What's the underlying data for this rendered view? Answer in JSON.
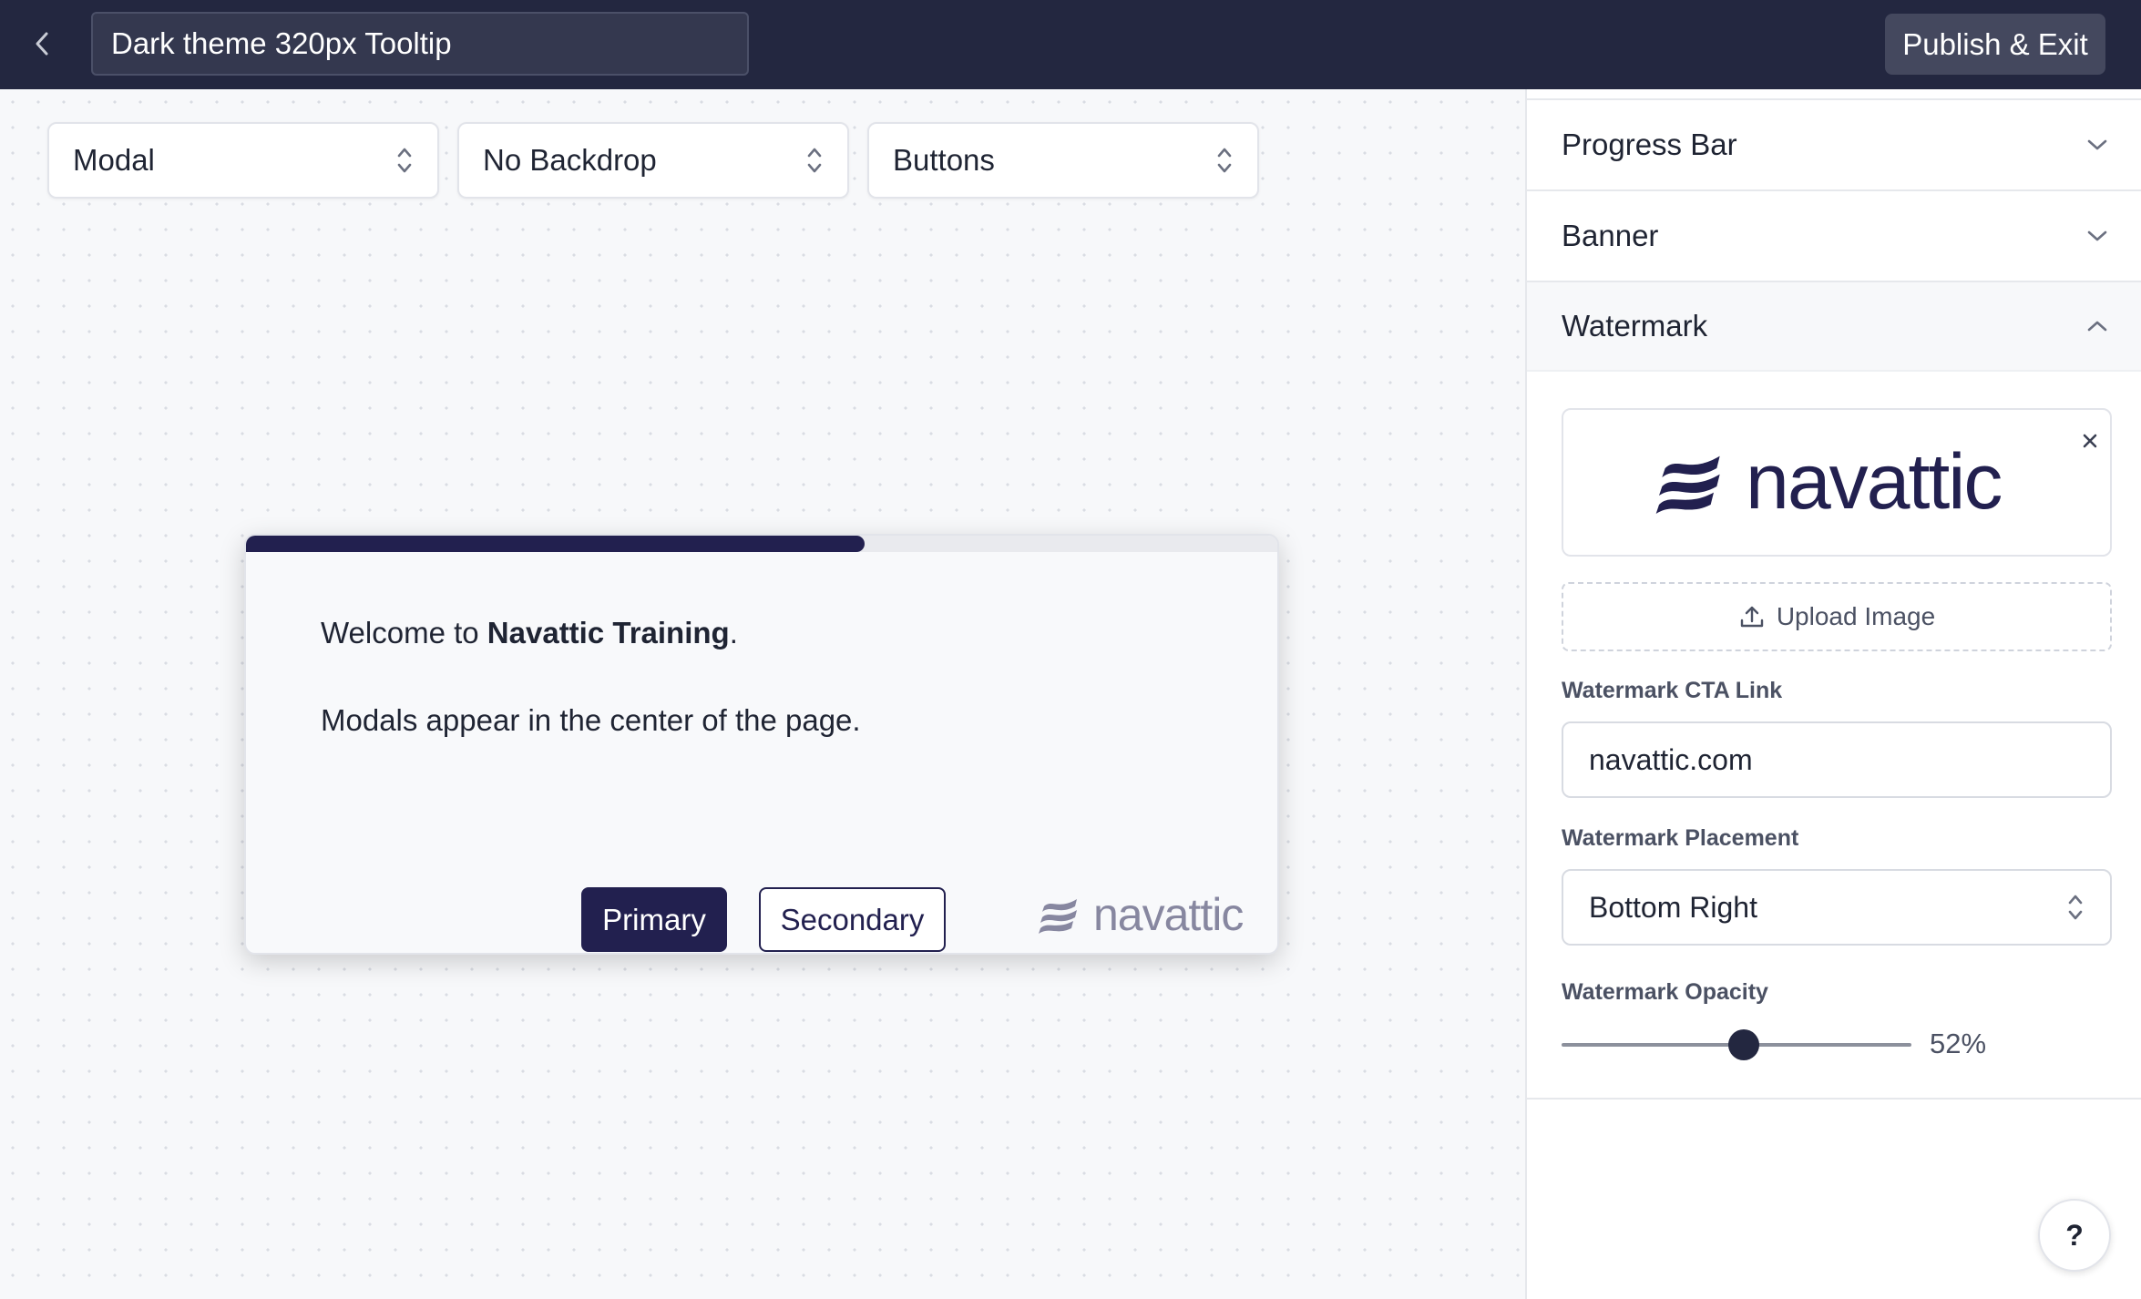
{
  "header": {
    "title_value": "Dark theme 320px Tooltip",
    "publish_label": "Publish & Exit"
  },
  "toolbar": {
    "type_select": "Modal",
    "backdrop_select": "No Backdrop",
    "footer_select": "Buttons"
  },
  "modal": {
    "progress": 0.6,
    "welcome_prefix": "Welcome to ",
    "welcome_bold": "Navattic Training",
    "welcome_suffix": ".",
    "body_text": "Modals appear in the center of the page.",
    "primary_label": "Primary",
    "secondary_label": "Secondary",
    "watermark_text": "navattic"
  },
  "panel": {
    "sections": {
      "progress_bar": "Progress Bar",
      "banner": "Banner",
      "watermark": "Watermark"
    },
    "logo_text": "navattic",
    "upload_label": "Upload Image",
    "cta_label": "Watermark CTA Link",
    "cta_value": "navattic.com",
    "placement_label": "Watermark Placement",
    "placement_value": "Bottom Right",
    "opacity_label": "Watermark Opacity",
    "opacity_value": "52%",
    "opacity_fraction": 0.52,
    "help_label": "?"
  },
  "colors": {
    "topbar": "#232740",
    "brand_navy": "#22204f",
    "canvas": "#f7f8fa"
  },
  "icons": [
    "back-chevron-icon",
    "select-updown-icon",
    "chevron-down-icon",
    "chevron-up-icon",
    "close-icon",
    "upload-icon",
    "navattic-logo-icon"
  ]
}
